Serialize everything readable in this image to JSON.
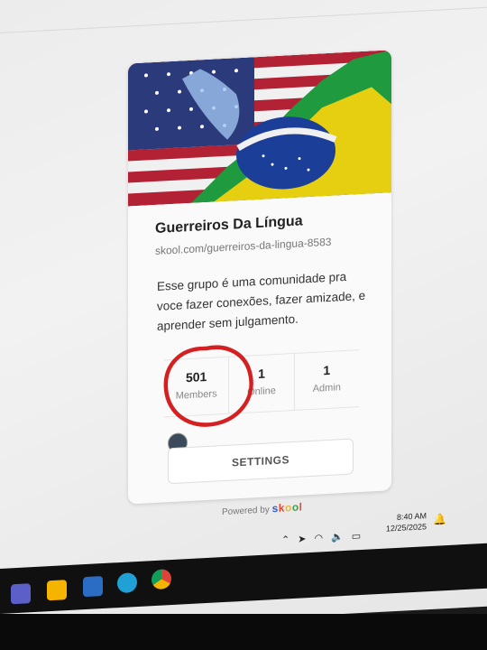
{
  "group": {
    "name": "Guerreiros Da Língua",
    "url": "skool.com/guerreiros-da-lingua-8583",
    "description": "Esse grupo é uma comunidade pra voce fazer conexões, fazer amizade, e aprender sem julgamento."
  },
  "stats": [
    {
      "value": "501",
      "label": "Members"
    },
    {
      "value": "1",
      "label": "Online"
    },
    {
      "value": "1",
      "label": "Admin"
    }
  ],
  "settings_label": "SETTINGS",
  "powered_by": "Powered by",
  "brand_letters": [
    "s",
    "k",
    "o",
    "o",
    "l"
  ],
  "taskbar": {
    "time": "8:40 AM",
    "date": "12/25/2025",
    "icons": [
      "teams-icon",
      "file-explorer-icon",
      "store-icon",
      "edge-icon",
      "chrome-icon"
    ]
  },
  "colors": {
    "brand_blue": "#2e5bd8",
    "brand_red": "#e04a3a",
    "brand_yellow": "#f2b233",
    "brand_green": "#2fa84f",
    "annotation_red": "#d42020"
  }
}
